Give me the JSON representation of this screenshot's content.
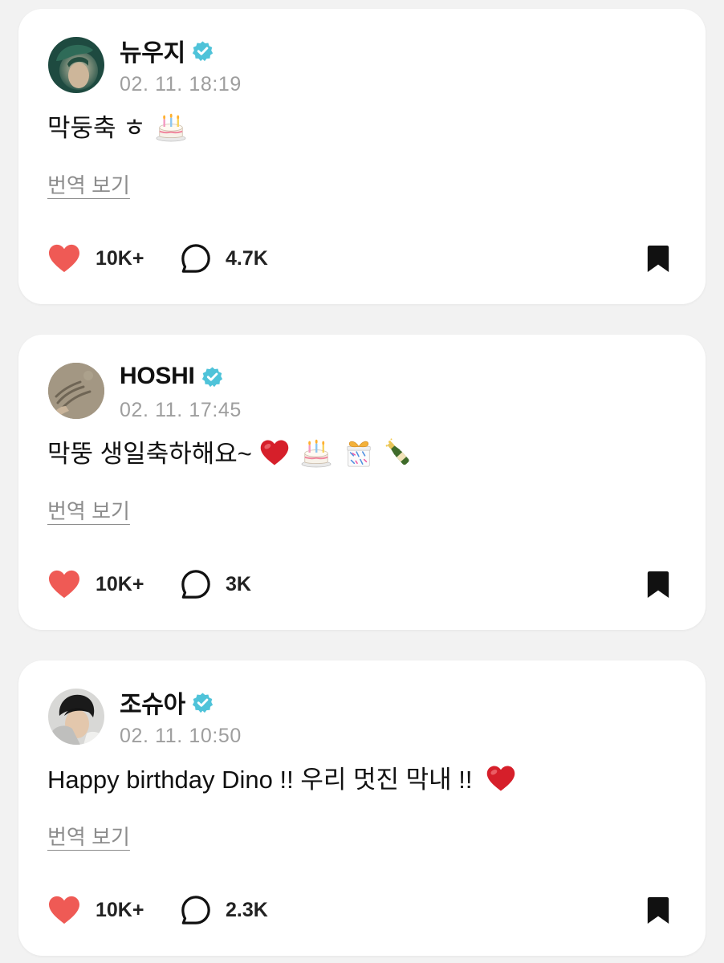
{
  "colors": {
    "background": "#f2f2f2",
    "card": "#ffffff",
    "verified_badge": "#4fc3d9",
    "like_heart": "#ef5a55",
    "timestamp_text": "#9e9e9e",
    "translate_text": "#8c8c8c"
  },
  "posts": [
    {
      "author": "뉴우지",
      "verified": true,
      "timestamp": "02. 11. 18:19",
      "text": "막둥축 ㅎ",
      "emoji": [
        "birthday-cake"
      ],
      "translate_label": "번역 보기",
      "likes": "10K+",
      "replies": "4.7K",
      "icons": {
        "like": "heart-icon",
        "reply": "comment-bubble-icon",
        "bookmark": "bookmark-icon"
      }
    },
    {
      "author": "HOSHI",
      "verified": true,
      "timestamp": "02. 11. 17:45",
      "text": "막뚱 생일축하해요~",
      "emoji": [
        "red-heart",
        "birthday-cake",
        "wrapped-gift",
        "champagne-bottle"
      ],
      "translate_label": "번역 보기",
      "likes": "10K+",
      "replies": "3K",
      "icons": {
        "like": "heart-icon",
        "reply": "comment-bubble-icon",
        "bookmark": "bookmark-icon"
      }
    },
    {
      "author": "조슈아",
      "verified": true,
      "timestamp": "02. 11. 10:50",
      "text": "Happy birthday Dino !! 우리 멋진 막내 !!",
      "emoji": [
        "red-heart"
      ],
      "translate_label": "번역 보기",
      "likes": "10K+",
      "replies": "2.3K",
      "icons": {
        "like": "heart-icon",
        "reply": "comment-bubble-icon",
        "bookmark": "bookmark-icon"
      }
    }
  ]
}
